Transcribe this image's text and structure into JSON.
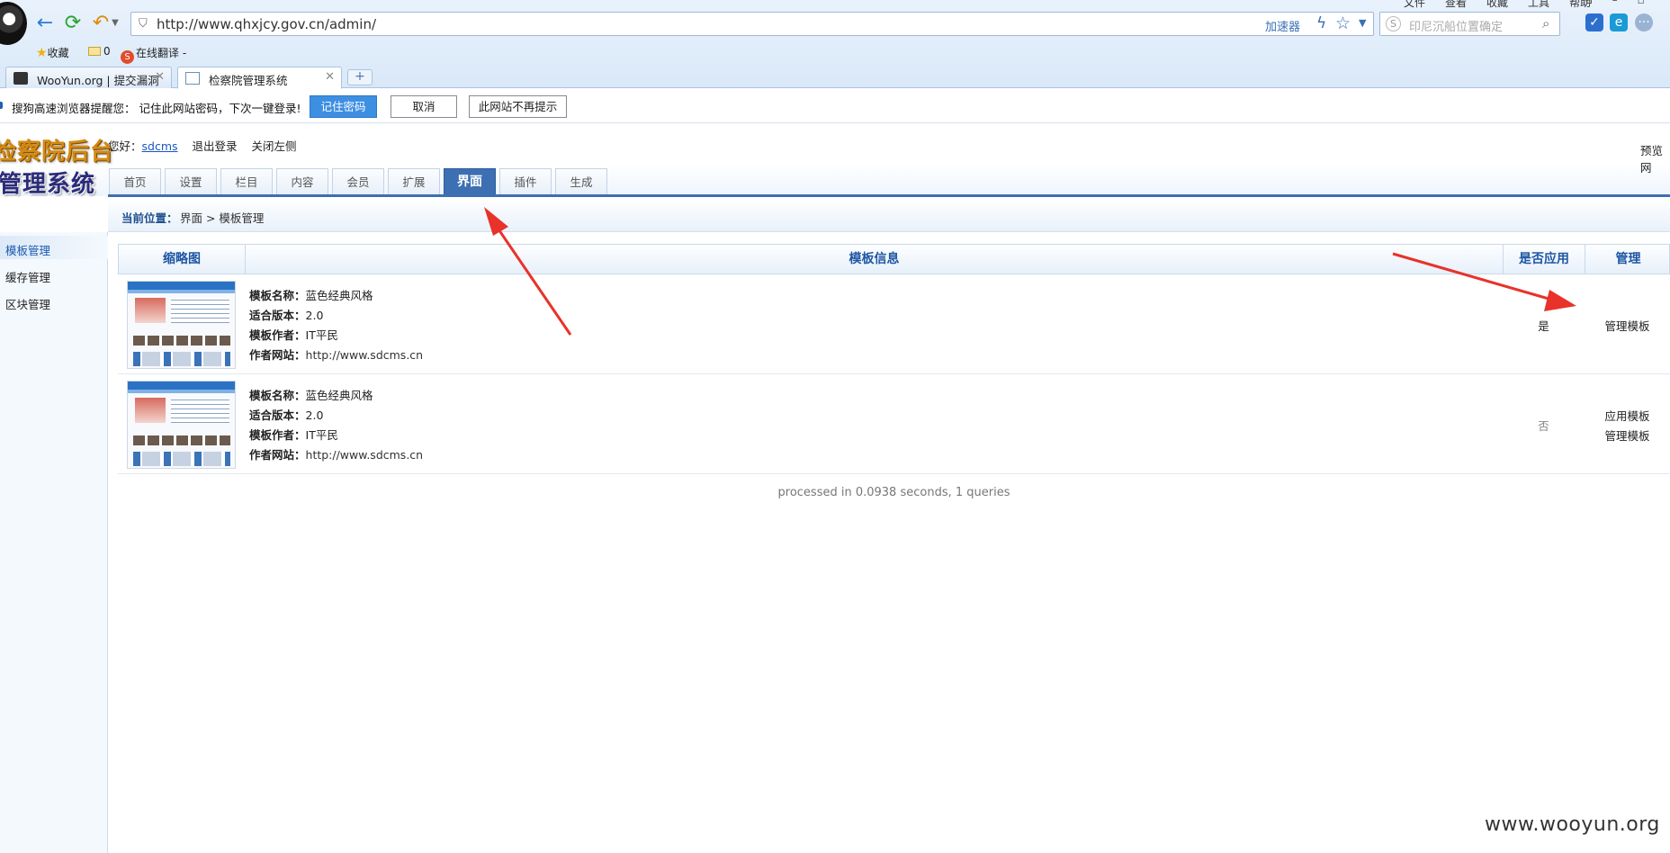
{
  "browser": {
    "address": "http://www.qhxjcy.gov.cn/admin/",
    "accelerator": "加速器",
    "search_placeholder": "印尼沉船位置确定",
    "top_menu": [
      "文件",
      "查看",
      "收藏",
      "工具",
      "帮助"
    ],
    "bookmarks": {
      "favorites": "收藏",
      "folder_count": "0",
      "translate": "在线翻译 -"
    },
    "tabs": [
      {
        "label": "WooYun.org | 提交漏洞"
      },
      {
        "label": "检察院管理系统"
      }
    ],
    "new_tab": "+"
  },
  "password_prompt": {
    "text": "搜狗高速浏览器提醒您：  记住此网站密码，下次一键登录!",
    "remember": "记住密码",
    "cancel": "取消",
    "never": "此网站不再提示"
  },
  "admin": {
    "logo_line1": "检察院后台",
    "logo_line2": "管理系统",
    "greeting_prefix": "您好：",
    "username": "sdcms",
    "logout": "退出登录",
    "close_left": "关闭左侧",
    "preview": "预览网",
    "tabs": [
      "首页",
      "设置",
      "栏目",
      "内容",
      "会员",
      "扩展",
      "界面",
      "插件",
      "生成"
    ],
    "active_tab": "界面",
    "breadcrumb_label": "当前位置：",
    "breadcrumb_path": "界面 > 模板管理",
    "sidebar": [
      "模板管理",
      "缓存管理",
      "区块管理"
    ]
  },
  "table": {
    "headers": {
      "thumb": "缩略图",
      "info": "模板信息",
      "applied": "是否应用",
      "manage": "管理"
    },
    "labels": {
      "name": "模板名称：",
      "version": "适合版本：",
      "author": "模板作者：",
      "site": "作者网站："
    },
    "rows": [
      {
        "name": "蓝色经典风格",
        "version": "2.0",
        "author": "IT平民",
        "site": "http://www.sdcms.cn",
        "applied": "是",
        "actions": [
          "管理模板"
        ]
      },
      {
        "name": "蓝色经典风格",
        "version": "2.0",
        "author": "IT平民",
        "site": "http://www.sdcms.cn",
        "applied": "否",
        "actions": [
          "应用模板",
          "管理模板"
        ]
      }
    ]
  },
  "footer": "processed in 0.0938 seconds, 1 queries",
  "watermark": "www.wooyun.org",
  "colors": {
    "accent": "#3d6fb3",
    "arrow": "#e8322a",
    "remember_button": "#3d8fe2"
  }
}
